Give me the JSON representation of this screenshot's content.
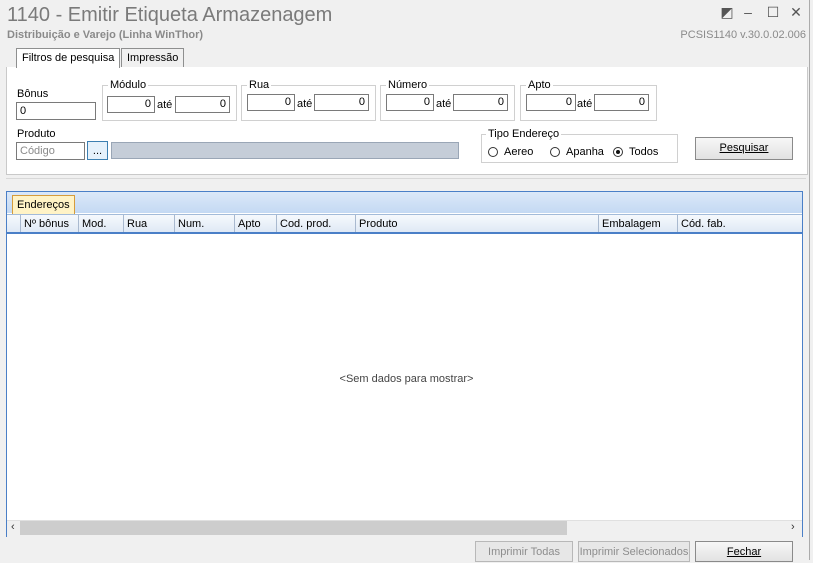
{
  "window": {
    "title": "1140 - Emitir Etiqueta Armazenagem",
    "subtitle": "Distribuição e Varejo (Linha WinThor)",
    "version": "PCSIS1140  v.30.0.02.006",
    "controls": {
      "restore": "◩",
      "minimize": "–",
      "maximize": "☐",
      "close": "✕"
    }
  },
  "tabs": [
    {
      "label": "Filtros de pesquisa",
      "active": true
    },
    {
      "label": "Impressão",
      "active": false
    }
  ],
  "filters": {
    "bonus": {
      "label": "Bônus",
      "value": "0"
    },
    "modulo": {
      "label": "Módulo",
      "from": "0",
      "sep": "até",
      "to": "0"
    },
    "rua": {
      "label": "Rua",
      "from": "0",
      "sep": "até",
      "to": "0"
    },
    "numero": {
      "label": "Número",
      "from": "0",
      "sep": "até",
      "to": "0"
    },
    "apto": {
      "label": "Apto",
      "from": "0",
      "sep": "até",
      "to": "0"
    },
    "produto": {
      "label": "Produto",
      "placeholder": "Código",
      "lookup": "...",
      "description": ""
    },
    "tipo_endereco": {
      "label": "Tipo Endereço",
      "options": [
        {
          "label": "Aereo",
          "selected": false
        },
        {
          "label": "Apanha",
          "selected": false
        },
        {
          "label": "Todos",
          "selected": true
        }
      ]
    },
    "search_button": "Pesquisar"
  },
  "grid": {
    "tab_label": "Endereços",
    "columns": [
      "Nº bônus",
      "Mod.",
      "Rua",
      "Num.",
      "Apto",
      "Cod. prod.",
      "Produto",
      "Embalagem",
      "Cód. fab."
    ],
    "empty_message": "<Sem dados para mostrar>",
    "scroll_left": "‹",
    "scroll_right": "›"
  },
  "footer": {
    "print_all": "Imprimir Todas",
    "print_selected": "Imprimir Selecionados",
    "close": "Fechar"
  }
}
